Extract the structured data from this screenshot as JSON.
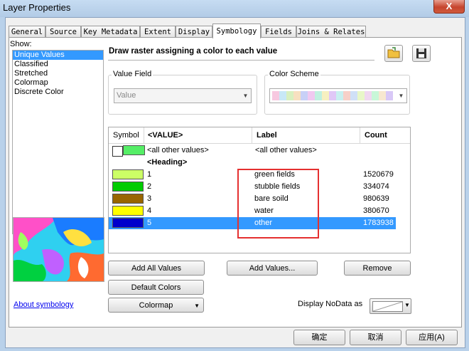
{
  "window": {
    "title": "Layer Properties",
    "close_label": "X"
  },
  "tabs": [
    {
      "label": "General"
    },
    {
      "label": "Source"
    },
    {
      "label": "Key Metadata"
    },
    {
      "label": "Extent"
    },
    {
      "label": "Display"
    },
    {
      "label": "Symbology",
      "active": true
    },
    {
      "label": "Fields"
    },
    {
      "label": "Joins & Relates"
    }
  ],
  "show": {
    "label": "Show:",
    "items": [
      "Unique Values",
      "Classified",
      "Stretched",
      "Colormap",
      "Discrete Color"
    ],
    "selected": "Unique Values",
    "about_link": "About symbology"
  },
  "description": "Draw raster assigning a color to each value",
  "value_field": {
    "label": "Value Field",
    "value": "Value"
  },
  "color_scheme": {
    "label": "Color Scheme",
    "colors": [
      "#f7c8e0",
      "#c8e8f7",
      "#d8f0c0",
      "#f7e0c0",
      "#c8d0f7",
      "#f0c8f0",
      "#c0f0e0",
      "#f7f0c0",
      "#e0c8f7",
      "#c8f0f0",
      "#f7d0c8",
      "#d0e0f7",
      "#e8f7c8",
      "#f0d8f0",
      "#c8f7d8",
      "#f7e8d0",
      "#d8c8f7"
    ]
  },
  "table": {
    "headers": {
      "symbol": "Symbol",
      "value": "<VALUE>",
      "label": "Label",
      "count": "Count"
    },
    "other_row": {
      "value": "<all other values>",
      "label": "<all other values>",
      "color": "#55ee66"
    },
    "heading_row": "<Heading>",
    "rows": [
      {
        "value": "1",
        "label": "green fields",
        "count": "1520679",
        "color": "#ccff66"
      },
      {
        "value": "2",
        "label": "stubble fields",
        "count": "334074",
        "color": "#00cc00"
      },
      {
        "value": "3",
        "label": "bare soild",
        "count": "980639",
        "color": "#996600"
      },
      {
        "value": "4",
        "label": "water",
        "count": "380670",
        "color": "#ffff00"
      },
      {
        "value": "5",
        "label": "other",
        "count": "1783938",
        "color": "#0000cc",
        "selected": true
      }
    ]
  },
  "buttons": {
    "add_all": "Add All Values",
    "add_values": "Add Values...",
    "remove": "Remove",
    "default_colors": "Default Colors",
    "colormap": "Colormap",
    "nodata_label": "Display NoData as"
  },
  "dialog": {
    "ok": "确定",
    "cancel": "取消",
    "apply": "应用(A)"
  }
}
